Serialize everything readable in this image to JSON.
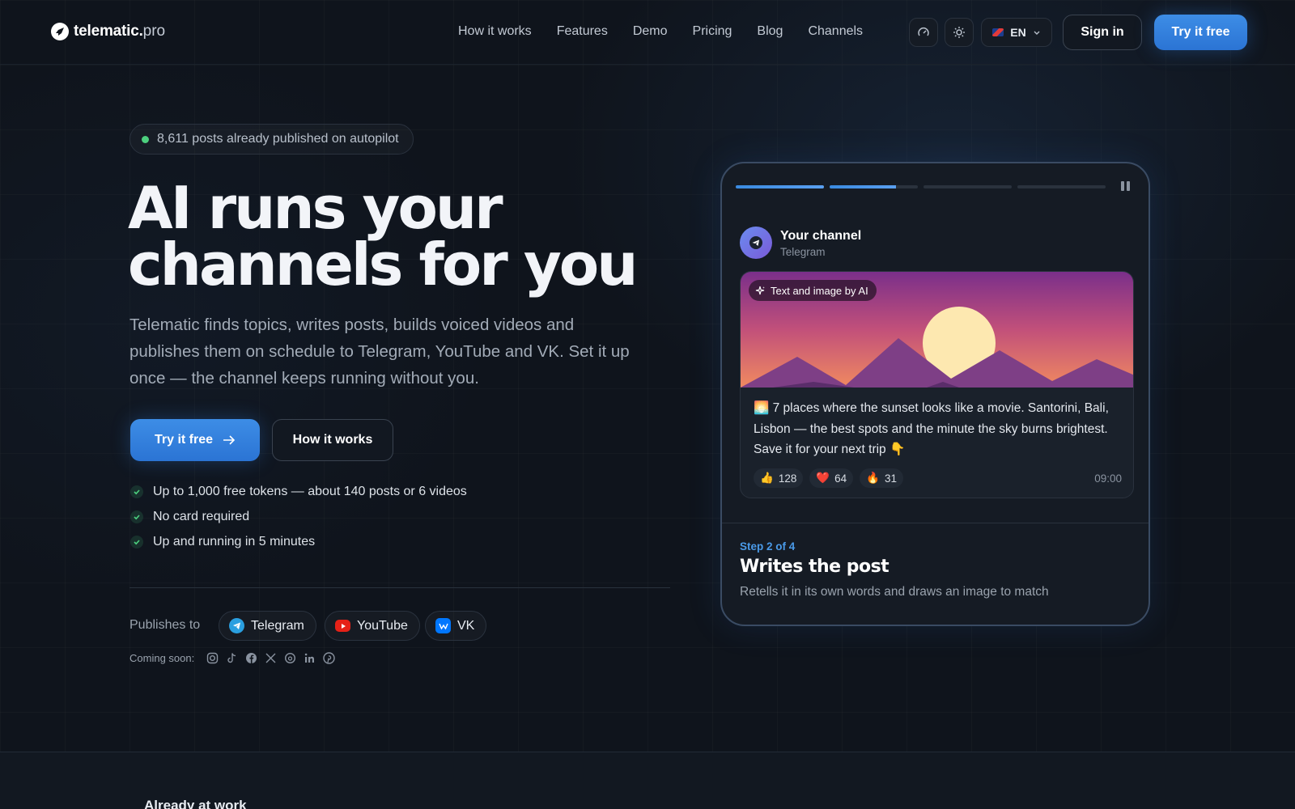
{
  "nav": {
    "logo_name": "telematic.",
    "logo_tld": "pro",
    "menu": [
      "How it works",
      "Features",
      "Demo",
      "Pricing",
      "Blog",
      "Channels"
    ],
    "lang": "EN",
    "signin": "Sign in",
    "try": "Try it free"
  },
  "hero": {
    "pill": "8,611 posts already published on autopilot",
    "title_line1": "AI runs your",
    "title_line2": "channels for you",
    "subtitle": "Telematic finds topics, writes posts, builds voiced videos and publishes them on schedule to Telegram, YouTube and VK. Set it up once — the channel keeps running without you.",
    "cta_primary": "Try it free",
    "cta_secondary": "How it works",
    "checks": [
      "Up to 1,000 free tokens — about 140 posts or 6 videos",
      "No card required",
      "Up and running in 5 minutes"
    ],
    "publishes_label": "Publishes to",
    "channels": [
      "Telegram",
      "YouTube",
      "VK"
    ],
    "coming_soon_label": "Coming soon:",
    "coming_soon_icons": [
      "instagram-icon",
      "tiktok-icon",
      "facebook-icon",
      "x-icon",
      "threads-icon",
      "linkedin-icon",
      "pinterest-icon"
    ]
  },
  "demo": {
    "progress": [
      1.0,
      0.75,
      0,
      0
    ],
    "channel_name": "Your channel",
    "channel_platform": "Telegram",
    "ai_badge": "Text and image by AI",
    "post_text": "🌅 7 places where the sunset looks like a movie. Santorini, Bali, Lisbon — the best spots and the minute the sky burns brightest. Save it for your next trip 👇",
    "reactions": [
      {
        "emoji": "👍",
        "count": "128"
      },
      {
        "emoji": "❤️",
        "count": "64"
      },
      {
        "emoji": "🔥",
        "count": "31"
      }
    ],
    "time": "09:00",
    "step_label": "Step 2 of 4",
    "step_title": "Writes the post",
    "step_desc": "Retells it in its own words and draws an image to match"
  },
  "bottom": {
    "heading": "Already at work"
  },
  "colors": {
    "accent": "#3a86e0",
    "background": "#0f141c",
    "success": "#4ccf7e"
  }
}
